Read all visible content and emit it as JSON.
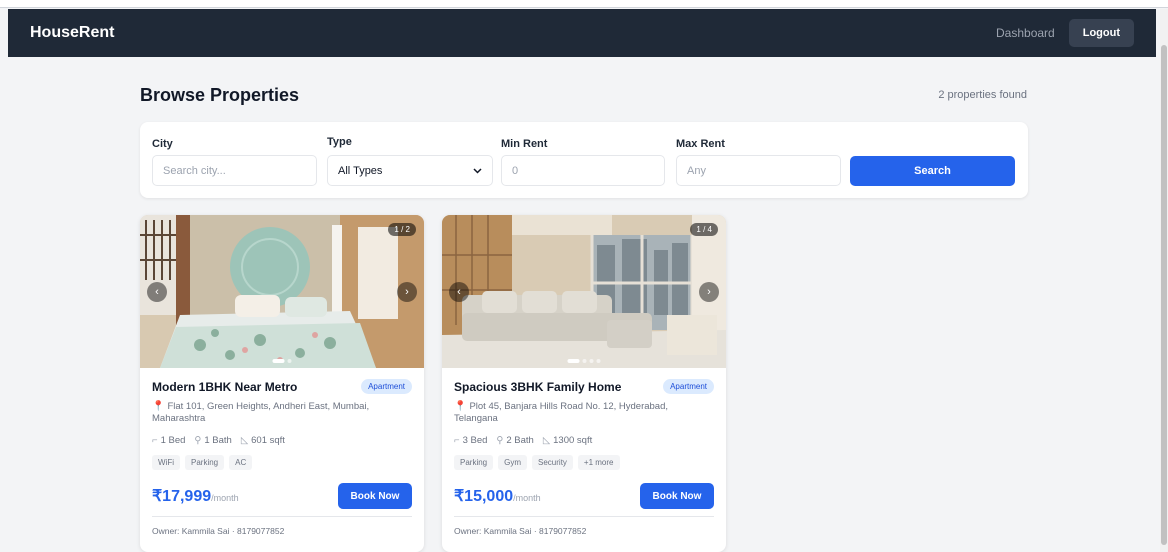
{
  "navbar": {
    "brand": "HouseRent",
    "dashboard_label": "Dashboard",
    "logout_label": "Logout"
  },
  "header": {
    "title": "Browse Properties",
    "count_text": "2 properties found"
  },
  "filters": {
    "city": {
      "label": "City",
      "placeholder": "Search city..."
    },
    "type": {
      "label": "Type",
      "value": "All Types",
      "icon": "chevron-down-icon"
    },
    "min_rent": {
      "label": "Min Rent",
      "placeholder": "0"
    },
    "max_rent": {
      "label": "Max Rent",
      "placeholder": "Any"
    },
    "search_label": "Search"
  },
  "listings": [
    {
      "image_counter": "1 / 2",
      "title": "Modern 1BHK Near Metro",
      "type_badge": "Apartment",
      "address": "Flat 101, Green Heights, Andheri East, Mumbai, Maharashtra",
      "beds": "1 Bed",
      "baths": "1 Bath",
      "area": "601 sqft",
      "amenities": [
        "WiFi",
        "Parking",
        "AC"
      ],
      "price": "₹17,999",
      "price_unit": "/month",
      "book_label": "Book Now",
      "owner": "Owner: Kammila Sai · 8179077852"
    },
    {
      "image_counter": "1 / 4",
      "title": "Spacious 3BHK Family Home",
      "type_badge": "Apartment",
      "address": "Plot 45, Banjara Hills Road No. 12, Hyderabad, Telangana",
      "beds": "3 Bed",
      "baths": "2 Bath",
      "area": "1300 sqft",
      "amenities": [
        "Parking",
        "Gym",
        "Security",
        "+1 more"
      ],
      "price": "₹15,000",
      "price_unit": "/month",
      "book_label": "Book Now",
      "owner": "Owner: Kammila Sai · 8179077852"
    }
  ],
  "colors": {
    "navbar": "#1f2937",
    "accent": "#2563eb",
    "badge_bg": "#dbeafe",
    "badge_text": "#1d4ed8"
  }
}
